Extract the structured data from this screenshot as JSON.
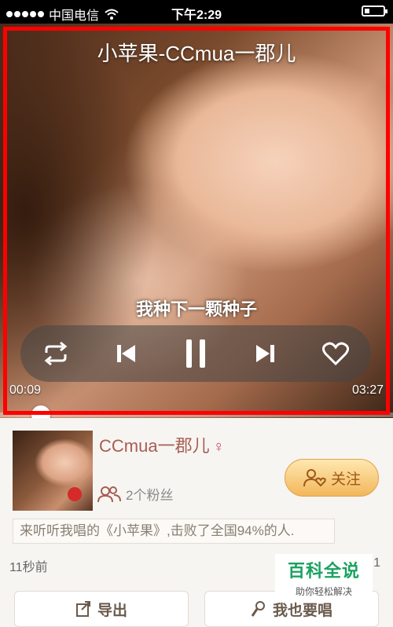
{
  "status_bar": {
    "carrier": "中国电信",
    "time": "下午2:29"
  },
  "player": {
    "song_title": "小苹果-CCmua一郡儿",
    "lyric": "我种下一颗种子",
    "current_time": "00:09",
    "total_time": "03:27",
    "progress": 0.043,
    "icons": [
      "repeat-icon",
      "previous-icon",
      "pause-icon",
      "next-icon",
      "heart-icon"
    ]
  },
  "singer": {
    "name": "CCmua一郡儿",
    "gender_symbol": "♀",
    "fans": "2个粉丝",
    "follow_label": "关注"
  },
  "description": "来听听我唱的《小苹果》,击败了全国94%的人.",
  "time_ago": "11秒前",
  "count_right": "1",
  "actions": {
    "export_label": "导出",
    "sing_label": "我也要唱"
  },
  "watermark": {
    "main": "百科全说",
    "sub": "助你轻松解决"
  },
  "colors": {
    "frame": "#ff0000",
    "accent": "#a85e52",
    "follow_button": "#f2b75a"
  }
}
